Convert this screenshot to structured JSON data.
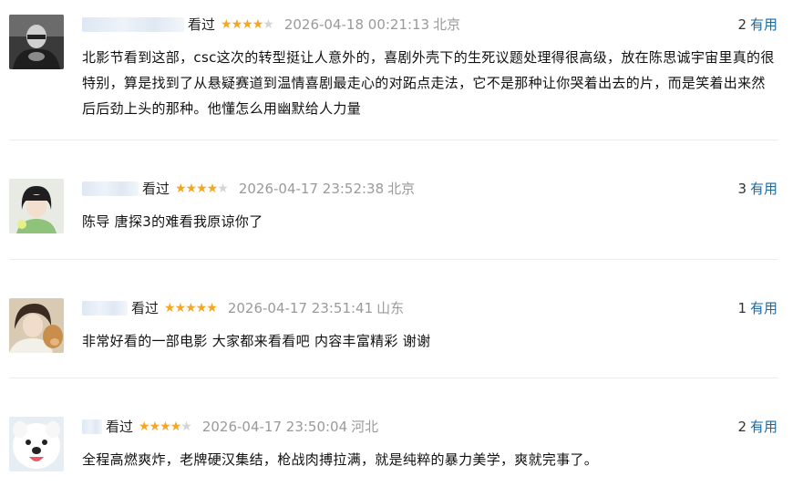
{
  "reviews": [
    {
      "seen_label": "看过",
      "rating": 4,
      "time": "2026-04-18 00:21:13",
      "location": "北京",
      "useful_count": "2",
      "useful_label": "有用",
      "content": "北影节看到这部，csc这次的转型挺让人意外的，喜剧外壳下的生死议题处理得很高级，放在陈思诚宇宙里真的很特别，算是找到了从悬疑赛道到温情喜剧最走心的对跖点走法，它不是那种让你哭着出去的片，而是笑着出来然后后劲上头的那种。他懂怎么用幽默给人力量"
    },
    {
      "seen_label": "看过",
      "rating": 4,
      "time": "2026-04-17 23:52:38",
      "location": "北京",
      "useful_count": "3",
      "useful_label": "有用",
      "content": "陈导 唐探3的难看我原谅你了"
    },
    {
      "seen_label": "看过",
      "rating": 5,
      "time": "2026-04-17 23:51:41",
      "location": "山东",
      "useful_count": "1",
      "useful_label": "有用",
      "content": "非常好看的一部电影 大家都来看看吧 内容丰富精彩 谢谢"
    },
    {
      "seen_label": "看过",
      "rating": 4,
      "time": "2026-04-17 23:50:04",
      "location": "河北",
      "useful_count": "2",
      "useful_label": "有用",
      "content": "全程高燃爽炸，老牌硬汉集结，枪战肉搏拉满，就是纯粹的暴力美学，爽就完事了。"
    }
  ],
  "colors": {
    "star": "#f5a623",
    "star_off": "#d5d5d5",
    "link": "#1a6aa6",
    "muted": "#9a9a9a"
  }
}
